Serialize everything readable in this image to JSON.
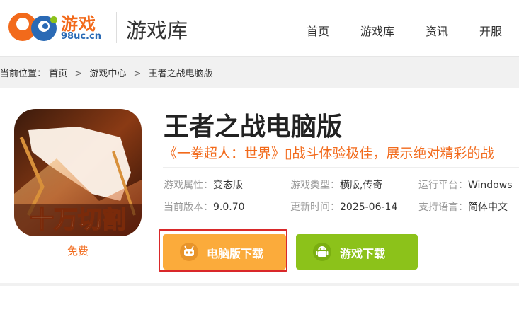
{
  "header": {
    "logo": {
      "word": "游戏",
      "domain": "98uc.cn",
      "digits": "98"
    },
    "section_title": "游戏库",
    "nav": [
      {
        "label": "首页"
      },
      {
        "label": "游戏库"
      },
      {
        "label": "资讯"
      },
      {
        "label": "开服"
      }
    ]
  },
  "breadcrumb": {
    "prefix": "当前位置：",
    "items": [
      "首页",
      "游戏中心",
      "王者之战电脑版"
    ],
    "separator": ">"
  },
  "game": {
    "icon_text": "十万切割",
    "price_label": "免费",
    "title": "王者之战电脑版",
    "tagline": "《一拳超人：世界》▯战斗体验极佳，展示绝对精彩的战",
    "info": {
      "attribute": {
        "key": "游戏属性：",
        "value": "变态版"
      },
      "type": {
        "key": "游戏类型：",
        "value": "横版,传奇"
      },
      "platform": {
        "key": "运行平台：",
        "value": "Windows"
      },
      "version": {
        "key": "当前版本：",
        "value": "9.0.70"
      },
      "updated": {
        "key": "更新时间：",
        "value": "2025-06-14"
      },
      "language": {
        "key": "支持语言：",
        "value": "简体中文"
      }
    },
    "buttons": {
      "pc_download": "电脑版下载",
      "game_download": "游戏下载"
    }
  },
  "colors": {
    "accent_orange": "#f26a1b",
    "pc_button": "#fbab3b",
    "game_button": "#8cc21a",
    "highlight": "#d9282a",
    "logo_blue": "#2a6ab5"
  },
  "icons": [
    "robot-icon",
    "android-icon"
  ]
}
